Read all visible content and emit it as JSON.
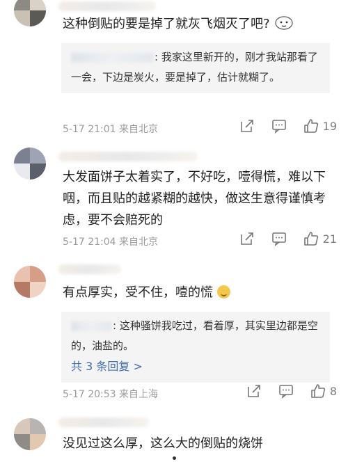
{
  "comments": [
    {
      "text": "这种倒贴的要是掉了就灰飞烟灭了吧?",
      "reply": {
        "text": ": 我家这里新开的，刚才我站那看了一会，下边是炭火，要是掉了，估计就糊了。"
      },
      "meta": "5-17 21:01 来自北京",
      "likes": "19"
    },
    {
      "text": "大发面饼子太着实了，不好吃，噎得慌，难以下咽，而且贴的越紧糊的越快，做这生意得谨慎考虑，要不会赔死的",
      "meta": "5-17 21:04 来自北京",
      "likes": "21"
    },
    {
      "text": "有点厚实，受不住，噎的慌",
      "reply": {
        "text": ": 这种骚饼我吃过，看着厚，其实里边都是空的，油盐的。",
        "more": "共 3 条回复 >"
      },
      "meta": "5-17 20:53 来自上海",
      "likes": "8"
    },
    {
      "text": "没见过这么厚，这么大的倒贴的烧饼"
    }
  ]
}
